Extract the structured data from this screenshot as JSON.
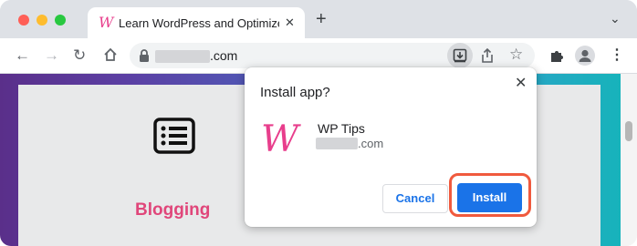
{
  "browser": {
    "tab": {
      "favicon": "W",
      "title": "Learn WordPress and Optimize",
      "close_glyph": "✕"
    },
    "new_tab_glyph": "+",
    "tab_menu_glyph": "⌄",
    "url_suffix": ".com",
    "icons": {
      "back": "arrow-left-icon",
      "forward": "arrow-right-icon",
      "reload": "reload-icon",
      "home": "home-icon",
      "lock": "lock-icon",
      "install": "install-app-icon",
      "share": "share-icon",
      "star": "star-icon",
      "extensions": "puzzle-icon",
      "profile": "profile-icon",
      "menu": "kebab-menu-icon"
    }
  },
  "page": {
    "section_label": "Blogging",
    "section_icon": "list-icon"
  },
  "dialog": {
    "title": "Install app?",
    "close_glyph": "✕",
    "app": {
      "logo": "W",
      "name": "WP Tips",
      "url_suffix": ".com"
    },
    "cancel_label": "Cancel",
    "install_label": "Install",
    "highlight_color": "#f05a3e"
  },
  "colors": {
    "accent_blue": "#1a73e8",
    "brand_pink": "#e83e8c"
  }
}
